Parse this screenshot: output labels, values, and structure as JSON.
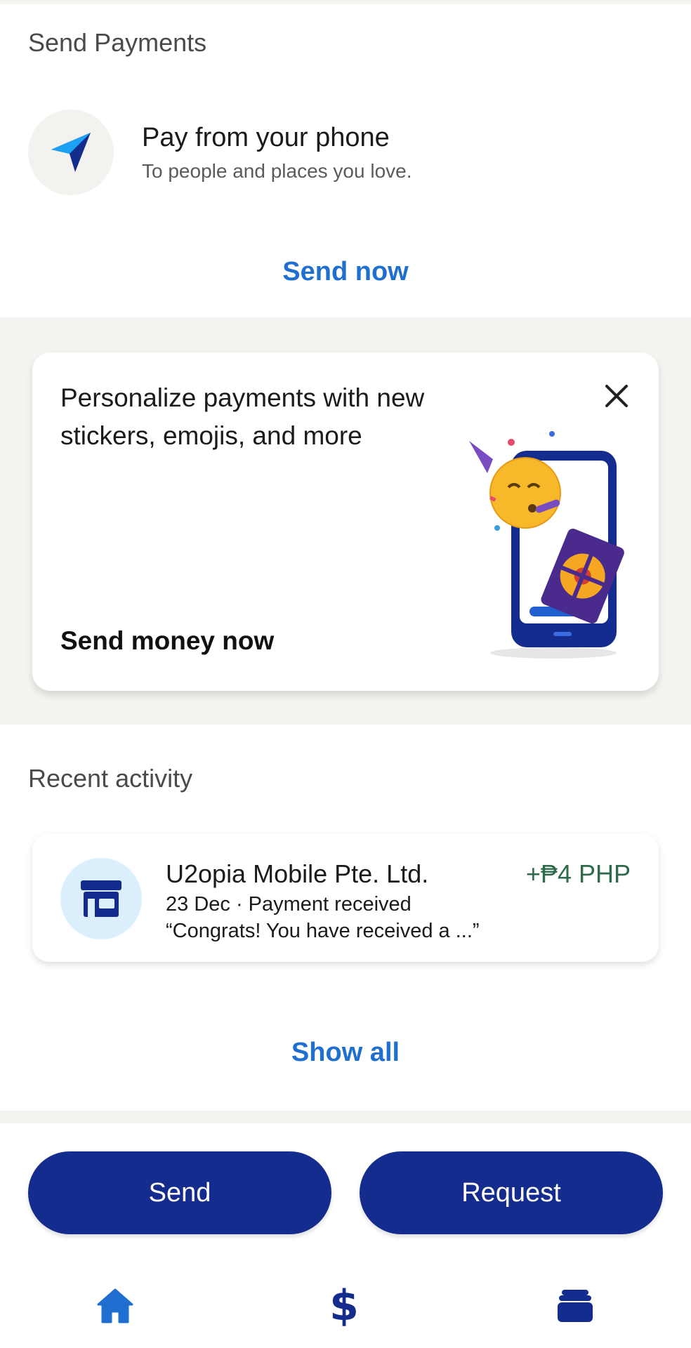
{
  "send_payments": {
    "title": "Send Payments",
    "icon": "paper-plane-icon",
    "headline": "Pay from your phone",
    "subtitle": "To people and places you love.",
    "link": "Send now"
  },
  "promo": {
    "text": "Personalize payments with new stickers, emojis, and more",
    "cta": "Send money now",
    "close_icon": "close-icon",
    "illustration": "phone-party-emoji-illustration"
  },
  "recent_activity": {
    "title": "Recent activity",
    "items": [
      {
        "name": "U2opia Mobile Pte. Ltd.",
        "amount": "+₱4 PHP",
        "meta": "23 Dec · Payment received",
        "note": "“Congrats! You have received a ...”",
        "icon": "store-icon"
      }
    ],
    "show_all": "Show all"
  },
  "actions": {
    "send": "Send",
    "request": "Request"
  },
  "nav": {
    "home_icon": "home-icon",
    "dollar_glyph": "$",
    "wallet_icon": "wallet-icon"
  },
  "colors": {
    "brand_navy": "#142c8e",
    "link_blue": "#1f6fd0",
    "amount_green": "#2e6b4a",
    "band_bg": "#f5f3ef"
  }
}
